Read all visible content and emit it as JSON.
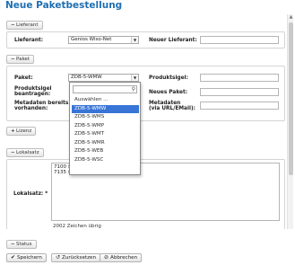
{
  "window": {
    "title": "Neue Paketbestellung"
  },
  "sections": {
    "lieferant": "Lieferant",
    "paket": "Paket",
    "lizenz": "Lizenz",
    "lokalsatz": "Lokalsatz",
    "status": "Status"
  },
  "lieferant": {
    "label": "Lieferant:",
    "value": "Genios Wiso-Net",
    "neuer_label": "Neuer Lieferant:"
  },
  "paket": {
    "paket_label": "Paket:",
    "paket_value": "ZDB-5-WMW",
    "sigel_label_1": "Produktsigel",
    "sigel_label_2": "beantragen:",
    "metadaten_label_1": "Metadaten bereits",
    "metadaten_label_2": "vorhanden:",
    "produktsigel_label": "Produktsigel:",
    "neues_paket_label": "Neues Paket:",
    "metadaten_url_label_1": "Metadaten",
    "metadaten_url_label_2": "(via URL/EMail):"
  },
  "dropdown": {
    "items": [
      "Auswählen ...",
      "ZDB-5-WMW",
      "ZDB-5-WMS",
      "ZDB-5-WMP",
      "ZDB-5-WMT",
      "ZDB-5-WMR",
      "ZDB-5-WEB",
      "ZDB-5-WSC"
    ],
    "selected_index": 1
  },
  "lokalsatz": {
    "label": "Lokalsatz: *",
    "line1": "7100 $",
    "line2": "7135 $",
    "counter": "2002 Zeichen übrig"
  },
  "footer": {
    "save": "Speichern",
    "reset": "Zurücksetzen",
    "cancel": "Abbrechen"
  },
  "colors": {
    "title": "#1f6fb2",
    "selected": "#3875d7"
  }
}
